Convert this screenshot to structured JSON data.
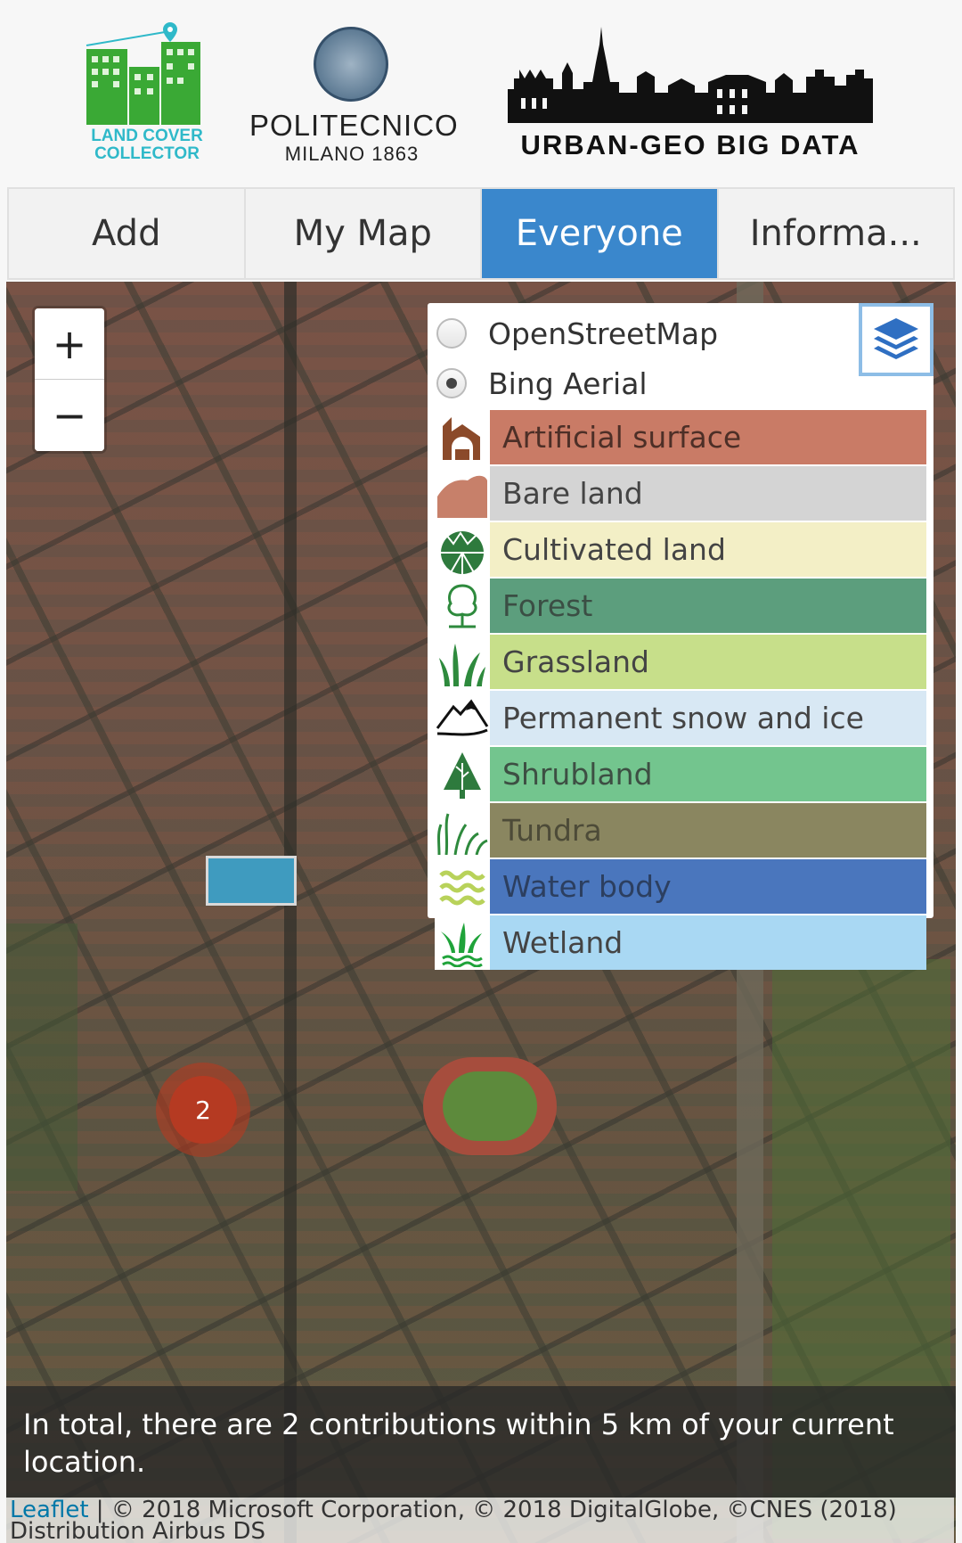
{
  "header": {
    "logo_lcc": {
      "line1": "LAND COVER",
      "line2": "COLLECTOR"
    },
    "logo_poli": {
      "name": "POLITECNICO",
      "sub": "MILANO 1863"
    },
    "logo_ugbd": {
      "name": "URBAN-GEO BIG DATA"
    }
  },
  "tabs": [
    {
      "label": "Add",
      "active": false
    },
    {
      "label": "My Map",
      "active": false
    },
    {
      "label": "Everyone",
      "active": true
    },
    {
      "label": "Informa..."
    }
  ],
  "map": {
    "zoom_in": "+",
    "zoom_out": "−",
    "cluster_count": "2",
    "base_layers": [
      {
        "label": "OpenStreetMap",
        "selected": false
      },
      {
        "label": "Bing Aerial",
        "selected": true
      }
    ],
    "land_cover": [
      {
        "label": "Artificial surface",
        "color": "#c97b66",
        "text_color": "#4d2f27",
        "icon": "building-icon"
      },
      {
        "label": "Bare land",
        "color": "#d4d4d4",
        "text_color": "#444",
        "icon": "bare-land-icon"
      },
      {
        "label": "Cultivated land",
        "color": "#f3efc6",
        "text_color": "#444",
        "icon": "field-icon"
      },
      {
        "label": "Forest",
        "color": "#5c9e7d",
        "text_color": "#3b4e44",
        "icon": "tree-icon"
      },
      {
        "label": "Grassland",
        "color": "#c7df8a",
        "text_color": "#444",
        "icon": "grass-icon"
      },
      {
        "label": "Permanent snow and ice",
        "color": "#d8e8f4",
        "text_color": "#444",
        "icon": "mountain-icon"
      },
      {
        "label": "Shrubland",
        "color": "#73c58e",
        "text_color": "#3d4f43",
        "icon": "shrub-icon"
      },
      {
        "label": "Tundra",
        "color": "#8a8660",
        "text_color": "#4d4b38",
        "icon": "tundra-icon"
      },
      {
        "label": "Water body",
        "color": "#4a76bd",
        "text_color": "#2c3f60",
        "icon": "water-icon"
      },
      {
        "label": "Wetland",
        "color": "#a9d8f3",
        "text_color": "#444",
        "icon": "wetland-icon"
      }
    ],
    "info_text": "In total, there are 2 contributions within 5 km of your current location.",
    "attribution_link": "Leaflet",
    "attribution_text": " | © 2018 Microsoft Corporation, © 2018 DigitalGlobe, ©CNES (2018) Distribution Airbus DS"
  }
}
